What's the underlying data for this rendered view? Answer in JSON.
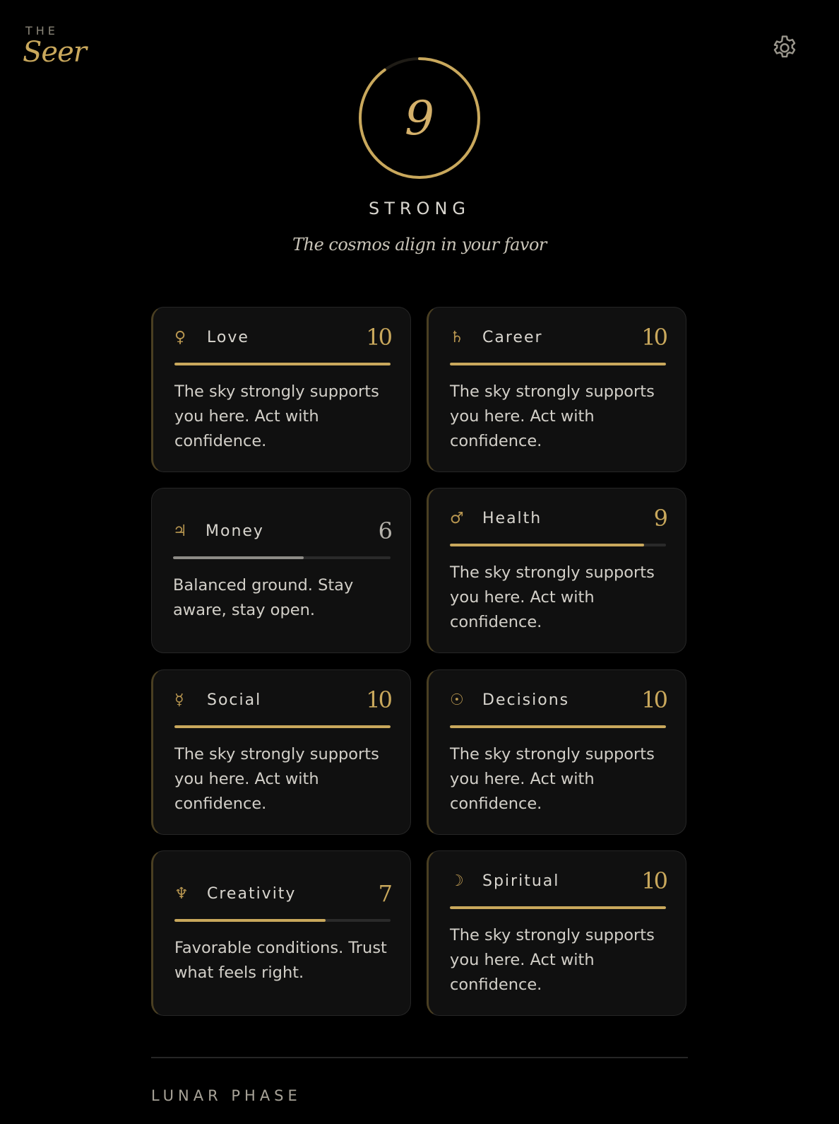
{
  "brand": {
    "top": "THE",
    "main": "Seer"
  },
  "header": {
    "settings_icon": "gear-icon"
  },
  "overall": {
    "score": "9",
    "score_value": 9,
    "score_max": 10,
    "label": "STRONG",
    "tagline": "The cosmos align in your favor"
  },
  "colors": {
    "accent": "#c9a85c",
    "background": "#000000",
    "card": "#101010",
    "neutral": "#8e8c87"
  },
  "categories": [
    {
      "icon": "venus-icon",
      "glyph": "♀",
      "title": "Love",
      "score": "10",
      "level": 1.0,
      "text": "The sky strongly supports you here. Act with confidence."
    },
    {
      "icon": "saturn-icon",
      "glyph": "♄",
      "title": "Career",
      "score": "10",
      "level": 1.0,
      "text": "The sky strongly supports you here. Act with confidence."
    },
    {
      "icon": "jupiter-icon",
      "glyph": "♃",
      "title": "Money",
      "score": "6",
      "level": 0.6,
      "text": "Balanced ground. Stay aware, stay open."
    },
    {
      "icon": "mars-icon",
      "glyph": "♂",
      "title": "Health",
      "score": "9",
      "level": 0.9,
      "text": "The sky strongly supports you here. Act with confidence."
    },
    {
      "icon": "mercury-icon",
      "glyph": "☿",
      "title": "Social",
      "score": "10",
      "level": 1.0,
      "text": "The sky strongly supports you here. Act with confidence."
    },
    {
      "icon": "sun-icon",
      "glyph": "☉",
      "title": "Decisions",
      "score": "10",
      "level": 1.0,
      "text": "The sky strongly supports you here. Act with confidence."
    },
    {
      "icon": "neptune-icon",
      "glyph": "♆",
      "title": "Creativity",
      "score": "7",
      "level": 0.7,
      "text": "Favorable conditions. Trust what feels right."
    },
    {
      "icon": "moon-icon",
      "glyph": "☽",
      "title": "Spiritual",
      "score": "10",
      "level": 1.0,
      "text": "The sky strongly supports you here. Act with confidence."
    }
  ],
  "lunar": {
    "section_label": "LUNAR PHASE"
  }
}
